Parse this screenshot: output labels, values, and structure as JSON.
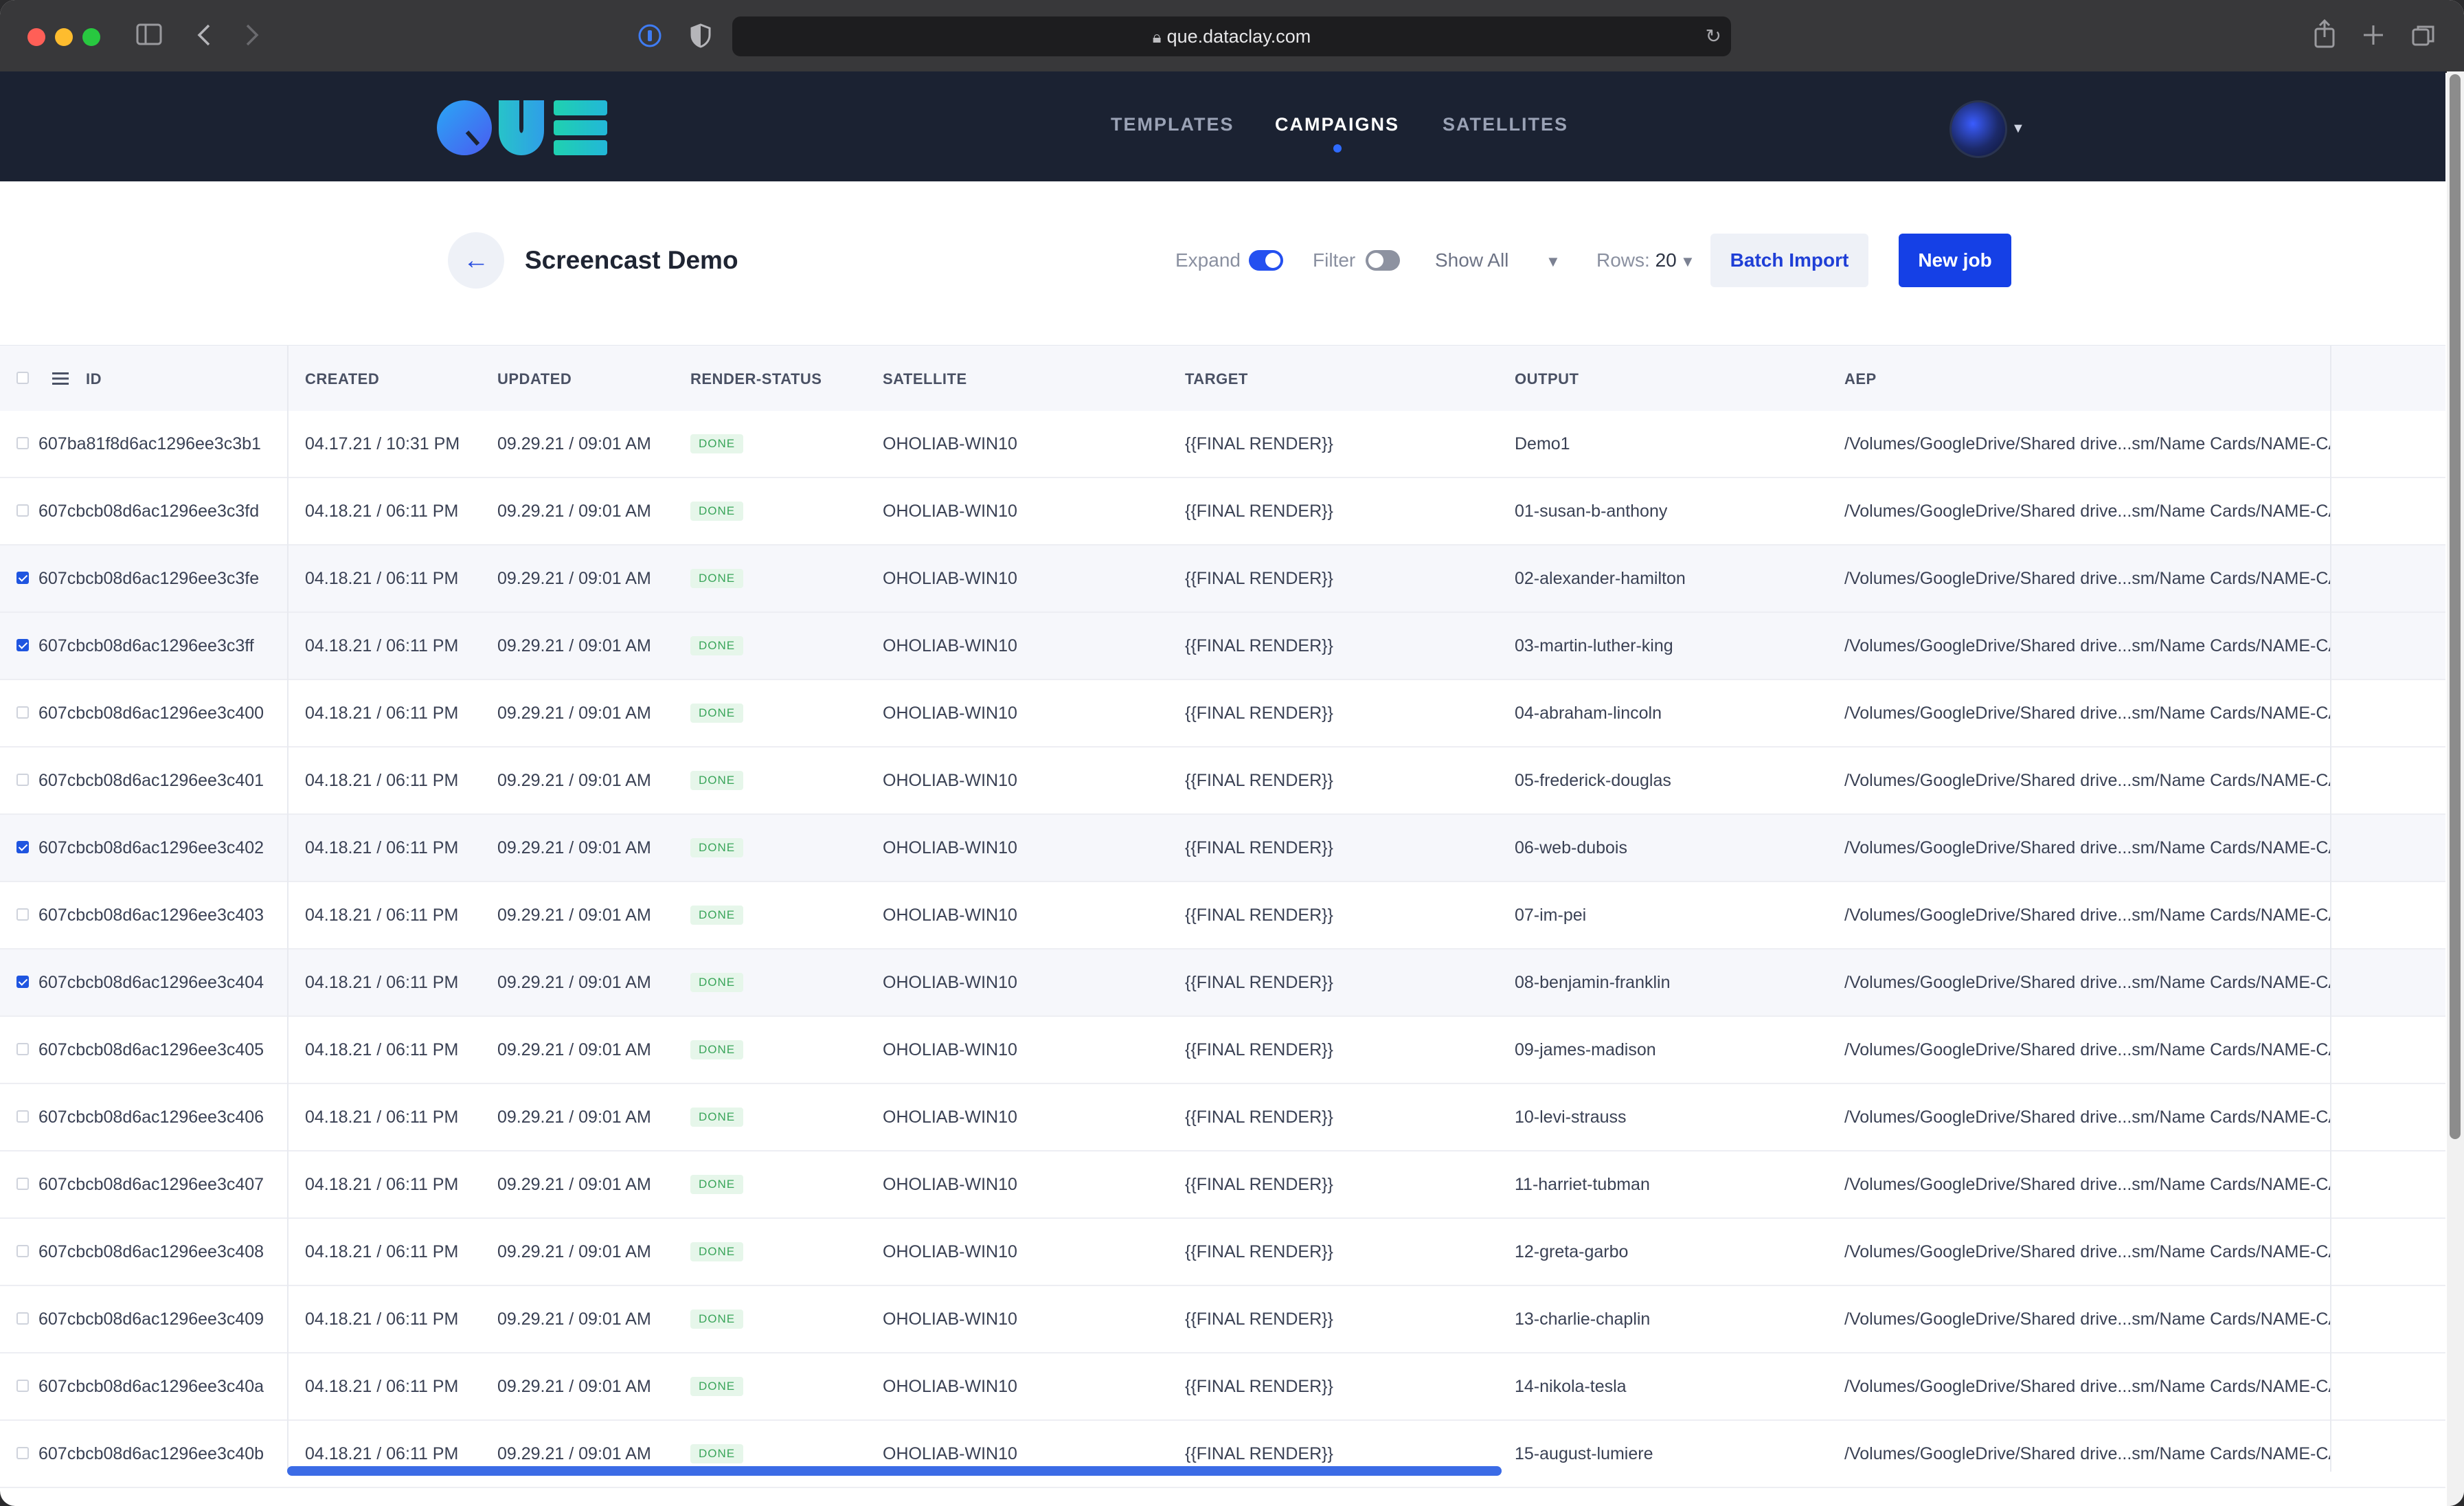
{
  "browser": {
    "url": "que.dataclay.com"
  },
  "app": {
    "logo_text": "QUE",
    "nav": [
      {
        "label": "TEMPLATES",
        "active": false
      },
      {
        "label": "CAMPAIGNS",
        "active": true
      },
      {
        "label": "SATELLITES",
        "active": false
      }
    ]
  },
  "toolbar": {
    "title": "Screencast Demo",
    "expand_label": "Expand",
    "expand_on": true,
    "filter_label": "Filter",
    "filter_on": false,
    "show_select": "Show All",
    "rows_label": "Rows:",
    "rows_value": "20",
    "batch_import": "Batch Import",
    "new_job": "New job"
  },
  "table": {
    "columns": [
      "ID",
      "CREATED",
      "UPDATED",
      "RENDER-STATUS",
      "SATELLITE",
      "TARGET",
      "OUTPUT",
      "AEP"
    ],
    "rows": [
      {
        "checked": false,
        "id": "607ba81f8d6ac1296ee3c3b1",
        "created": "04.17.21 / 10:31 PM",
        "updated": "09.29.21 / 09:01 AM",
        "status": "DONE",
        "satellite": "OHOLIAB-WIN10",
        "target": "{{FINAL RENDER}}",
        "output": "Demo1",
        "aep": "/Volumes/GoogleDrive/Shared drive...sm/Name Cards/NAME-CA"
      },
      {
        "checked": false,
        "id": "607cbcb08d6ac1296ee3c3fd",
        "created": "04.18.21 / 06:11 PM",
        "updated": "09.29.21 / 09:01 AM",
        "status": "DONE",
        "satellite": "OHOLIAB-WIN10",
        "target": "{{FINAL RENDER}}",
        "output": "01-susan-b-anthony",
        "aep": "/Volumes/GoogleDrive/Shared drive...sm/Name Cards/NAME-CA"
      },
      {
        "checked": true,
        "id": "607cbcb08d6ac1296ee3c3fe",
        "created": "04.18.21 / 06:11 PM",
        "updated": "09.29.21 / 09:01 AM",
        "status": "DONE",
        "satellite": "OHOLIAB-WIN10",
        "target": "{{FINAL RENDER}}",
        "output": "02-alexander-hamilton",
        "aep": "/Volumes/GoogleDrive/Shared drive...sm/Name Cards/NAME-CA"
      },
      {
        "checked": true,
        "id": "607cbcb08d6ac1296ee3c3ff",
        "created": "04.18.21 / 06:11 PM",
        "updated": "09.29.21 / 09:01 AM",
        "status": "DONE",
        "satellite": "OHOLIAB-WIN10",
        "target": "{{FINAL RENDER}}",
        "output": "03-martin-luther-king",
        "aep": "/Volumes/GoogleDrive/Shared drive...sm/Name Cards/NAME-CA"
      },
      {
        "checked": false,
        "id": "607cbcb08d6ac1296ee3c400",
        "created": "04.18.21 / 06:11 PM",
        "updated": "09.29.21 / 09:01 AM",
        "status": "DONE",
        "satellite": "OHOLIAB-WIN10",
        "target": "{{FINAL RENDER}}",
        "output": "04-abraham-lincoln",
        "aep": "/Volumes/GoogleDrive/Shared drive...sm/Name Cards/NAME-CA"
      },
      {
        "checked": false,
        "id": "607cbcb08d6ac1296ee3c401",
        "created": "04.18.21 / 06:11 PM",
        "updated": "09.29.21 / 09:01 AM",
        "status": "DONE",
        "satellite": "OHOLIAB-WIN10",
        "target": "{{FINAL RENDER}}",
        "output": "05-frederick-douglas",
        "aep": "/Volumes/GoogleDrive/Shared drive...sm/Name Cards/NAME-CA"
      },
      {
        "checked": true,
        "id": "607cbcb08d6ac1296ee3c402",
        "created": "04.18.21 / 06:11 PM",
        "updated": "09.29.21 / 09:01 AM",
        "status": "DONE",
        "satellite": "OHOLIAB-WIN10",
        "target": "{{FINAL RENDER}}",
        "output": "06-web-dubois",
        "aep": "/Volumes/GoogleDrive/Shared drive...sm/Name Cards/NAME-CA"
      },
      {
        "checked": false,
        "id": "607cbcb08d6ac1296ee3c403",
        "created": "04.18.21 / 06:11 PM",
        "updated": "09.29.21 / 09:01 AM",
        "status": "DONE",
        "satellite": "OHOLIAB-WIN10",
        "target": "{{FINAL RENDER}}",
        "output": "07-im-pei",
        "aep": "/Volumes/GoogleDrive/Shared drive...sm/Name Cards/NAME-CA"
      },
      {
        "checked": true,
        "id": "607cbcb08d6ac1296ee3c404",
        "created": "04.18.21 / 06:11 PM",
        "updated": "09.29.21 / 09:01 AM",
        "status": "DONE",
        "satellite": "OHOLIAB-WIN10",
        "target": "{{FINAL RENDER}}",
        "output": "08-benjamin-franklin",
        "aep": "/Volumes/GoogleDrive/Shared drive...sm/Name Cards/NAME-CA"
      },
      {
        "checked": false,
        "id": "607cbcb08d6ac1296ee3c405",
        "created": "04.18.21 / 06:11 PM",
        "updated": "09.29.21 / 09:01 AM",
        "status": "DONE",
        "satellite": "OHOLIAB-WIN10",
        "target": "{{FINAL RENDER}}",
        "output": "09-james-madison",
        "aep": "/Volumes/GoogleDrive/Shared drive...sm/Name Cards/NAME-CA"
      },
      {
        "checked": false,
        "id": "607cbcb08d6ac1296ee3c406",
        "created": "04.18.21 / 06:11 PM",
        "updated": "09.29.21 / 09:01 AM",
        "status": "DONE",
        "satellite": "OHOLIAB-WIN10",
        "target": "{{FINAL RENDER}}",
        "output": "10-levi-strauss",
        "aep": "/Volumes/GoogleDrive/Shared drive...sm/Name Cards/NAME-CA"
      },
      {
        "checked": false,
        "id": "607cbcb08d6ac1296ee3c407",
        "created": "04.18.21 / 06:11 PM",
        "updated": "09.29.21 / 09:01 AM",
        "status": "DONE",
        "satellite": "OHOLIAB-WIN10",
        "target": "{{FINAL RENDER}}",
        "output": "11-harriet-tubman",
        "aep": "/Volumes/GoogleDrive/Shared drive...sm/Name Cards/NAME-CA"
      },
      {
        "checked": false,
        "id": "607cbcb08d6ac1296ee3c408",
        "created": "04.18.21 / 06:11 PM",
        "updated": "09.29.21 / 09:01 AM",
        "status": "DONE",
        "satellite": "OHOLIAB-WIN10",
        "target": "{{FINAL RENDER}}",
        "output": "12-greta-garbo",
        "aep": "/Volumes/GoogleDrive/Shared drive...sm/Name Cards/NAME-CA"
      },
      {
        "checked": false,
        "id": "607cbcb08d6ac1296ee3c409",
        "created": "04.18.21 / 06:11 PM",
        "updated": "09.29.21 / 09:01 AM",
        "status": "DONE",
        "satellite": "OHOLIAB-WIN10",
        "target": "{{FINAL RENDER}}",
        "output": "13-charlie-chaplin",
        "aep": "/Volumes/GoogleDrive/Shared drive...sm/Name Cards/NAME-CA"
      },
      {
        "checked": false,
        "id": "607cbcb08d6ac1296ee3c40a",
        "created": "04.18.21 / 06:11 PM",
        "updated": "09.29.21 / 09:01 AM",
        "status": "DONE",
        "satellite": "OHOLIAB-WIN10",
        "target": "{{FINAL RENDER}}",
        "output": "14-nikola-tesla",
        "aep": "/Volumes/GoogleDrive/Shared drive...sm/Name Cards/NAME-CA"
      },
      {
        "checked": false,
        "id": "607cbcb08d6ac1296ee3c40b",
        "created": "04.18.21 / 06:11 PM",
        "updated": "09.29.21 / 09:01 AM",
        "status": "DONE",
        "satellite": "OHOLIAB-WIN10",
        "target": "{{FINAL RENDER}}",
        "output": "15-august-lumiere",
        "aep": "/Volumes/GoogleDrive/Shared drive...sm/Name Cards/NAME-CA"
      }
    ]
  },
  "colors": {
    "header_bg": "#1b2232",
    "accent": "#1540e6",
    "status_done_bg": "#e6f6ea",
    "status_done_text": "#3aa55a"
  }
}
